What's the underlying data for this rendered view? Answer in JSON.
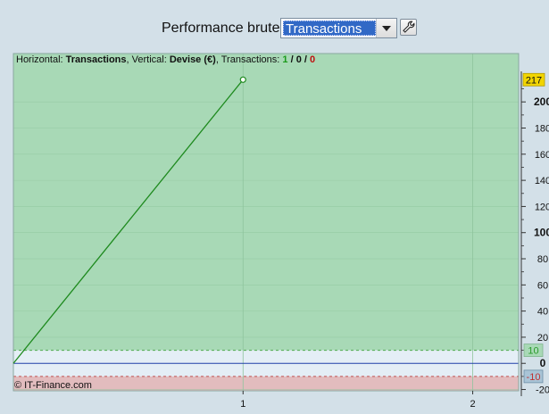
{
  "toolbar": {
    "title": "Performance brute",
    "select_value": "Transactions",
    "tool_icon": "wrench-icon"
  },
  "info": {
    "h_label": "Horizontal:",
    "h_value": "Transactions",
    "sep1": ",",
    "v_label": "Vertical:",
    "v_value": "Devise (€)",
    "sep2": ",",
    "t_label": "Transactions:",
    "t_total": "1",
    "t_slash1": " / ",
    "t_mid": "0",
    "t_slash2": " / ",
    "t_loss": "0"
  },
  "copyright": "© IT-Finance.com",
  "colors": {
    "profit_zone": "#a8d9b6",
    "loss_zone": "#e2bcbe",
    "neutral_zone": "#e4eef6",
    "line": "#1e8a1e",
    "zero_line": "#1f3fa8",
    "threshold_pos": "#4faa4f",
    "threshold_neg": "#c05050",
    "badge_last": "#f2d500",
    "badge_pos": "#a8d9b6",
    "badge_neg": "#a9c4d6"
  },
  "chart_data": {
    "type": "line",
    "xlabel": "Transactions",
    "ylabel": "Devise (€)",
    "xlim": [
      0,
      2.2
    ],
    "ylim": [
      -21,
      237
    ],
    "x_ticks": [
      1,
      2
    ],
    "y_ticks": [
      -20,
      0,
      20,
      40,
      60,
      80,
      100,
      120,
      140,
      160,
      180,
      200
    ],
    "y_ticks_bold": [
      0,
      100,
      200
    ],
    "grid": true,
    "x": [
      0,
      1
    ],
    "y": [
      0,
      217
    ],
    "last_value_label": "217",
    "profit_threshold": 10,
    "loss_threshold": -10,
    "threshold_labels": [
      "10",
      "-10"
    ],
    "markers": "circle at last point"
  }
}
